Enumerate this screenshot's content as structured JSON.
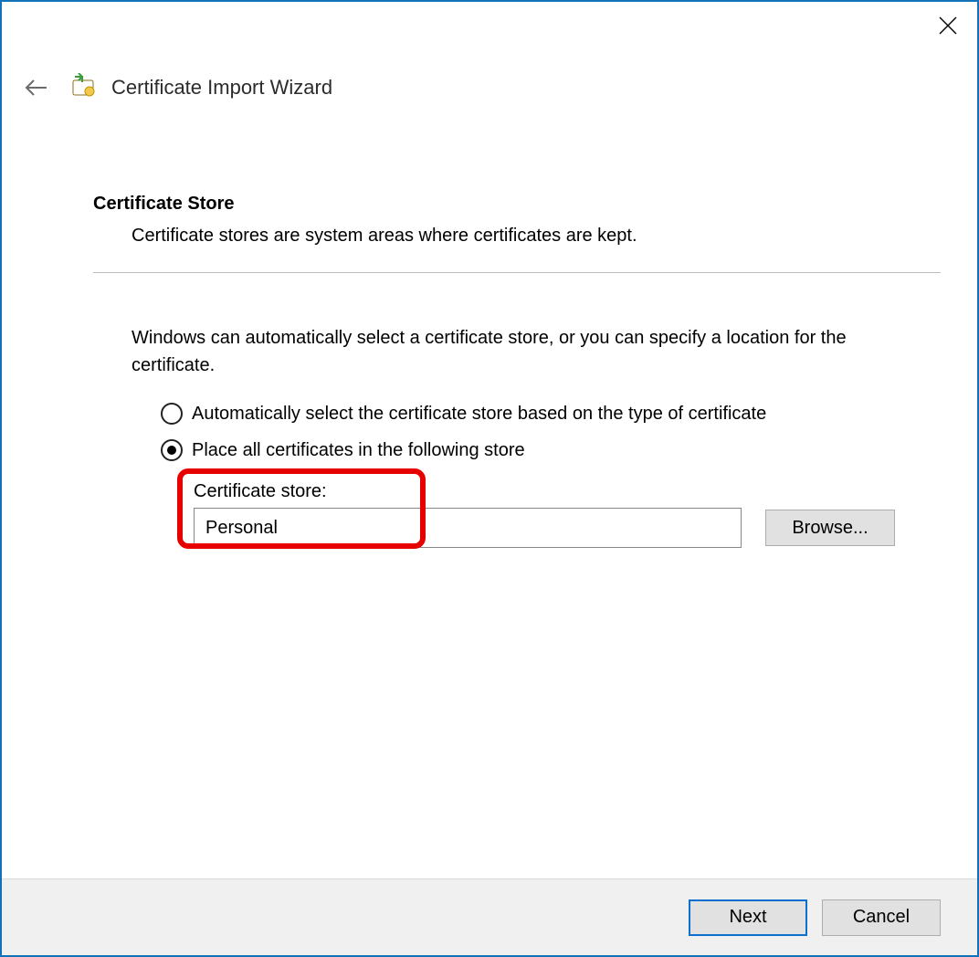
{
  "header": {
    "title": "Certificate Import Wizard"
  },
  "section": {
    "heading": "Certificate Store",
    "description": "Certificate stores are system areas where certificates are kept."
  },
  "body": {
    "intro": "Windows can automatically select a certificate store, or you can specify a location for the certificate.",
    "radio_auto": "Automatically select the certificate store based on the type of certificate",
    "radio_manual": "Place all certificates in the following store",
    "store_label": "Certificate store:",
    "store_value": "Personal",
    "browse_label": "Browse..."
  },
  "footer": {
    "next": "Next",
    "cancel": "Cancel"
  }
}
